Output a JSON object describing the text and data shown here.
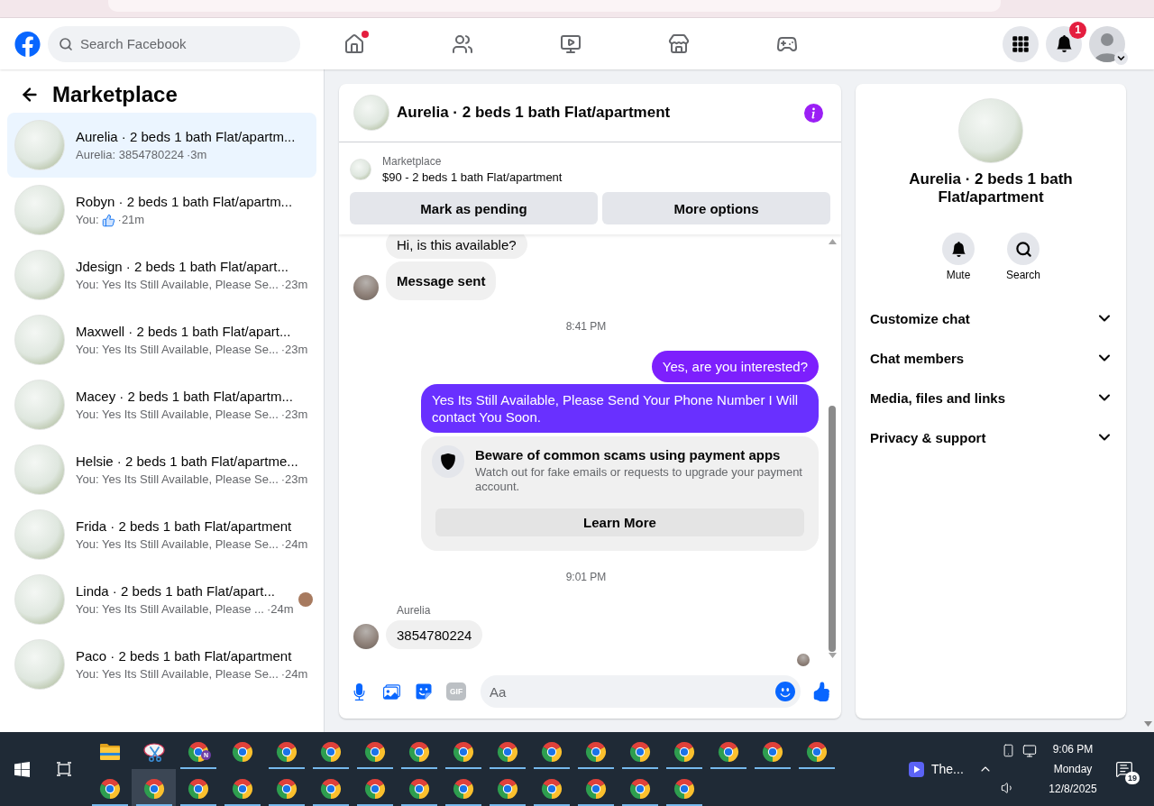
{
  "header": {
    "search": {
      "placeholder": "Search Facebook"
    },
    "nav": [
      {
        "kind": "home",
        "dot": true
      },
      {
        "kind": "friends",
        "dot": false
      },
      {
        "kind": "video",
        "dot": false
      },
      {
        "kind": "marketplace",
        "dot": false
      },
      {
        "kind": "gaming",
        "dot": false
      }
    ],
    "notification_count": "1"
  },
  "sidebar": {
    "title": "Marketplace",
    "conversations": [
      {
        "title": "Aurelia · 2 beds 1 bath Flat/apartm...",
        "kind": "text",
        "preview": "Aurelia: 3854780224",
        "time": "·3m",
        "selected": true,
        "seen": false
      },
      {
        "title": "Robyn · 2 beds 1 bath Flat/apartm...",
        "kind": "like",
        "preview": "You:",
        "time": "·21m",
        "selected": false,
        "seen": false
      },
      {
        "title": "Jdesign · 2 beds 1 bath Flat/apart...",
        "kind": "text",
        "preview": "You: Yes Its Still Available, Please Se...",
        "time": "·23m",
        "selected": false,
        "seen": false
      },
      {
        "title": "Maxwell · 2 beds 1 bath Flat/apart...",
        "kind": "text",
        "preview": "You: Yes Its Still Available, Please Se...",
        "time": "·23m",
        "selected": false,
        "seen": false
      },
      {
        "title": "Macey · 2 beds 1 bath Flat/apartm...",
        "kind": "text",
        "preview": "You: Yes Its Still Available, Please Se...",
        "time": "·23m",
        "selected": false,
        "seen": false
      },
      {
        "title": "Helsie · 2 beds 1 bath Flat/apartme...",
        "kind": "text",
        "preview": "You: Yes Its Still Available, Please Se...",
        "time": "·23m",
        "selected": false,
        "seen": false
      },
      {
        "title": "Frida · 2 beds 1 bath Flat/apartment",
        "kind": "text",
        "preview": "You: Yes Its Still Available, Please Se...",
        "time": "·24m",
        "selected": false,
        "seen": false
      },
      {
        "title": "Linda · 2 beds 1 bath Flat/apart...",
        "kind": "text",
        "preview": "You: Yes Its Still Available, Please ...",
        "time": "·24m",
        "selected": false,
        "seen": true
      },
      {
        "title": "Paco · 2 beds 1 bath Flat/apartment",
        "kind": "text",
        "preview": "You: Yes Its Still Available, Please Se...",
        "time": "·24m",
        "selected": false,
        "seen": false
      }
    ]
  },
  "chat": {
    "title": "Aurelia · 2 beds 1 bath Flat/apartment",
    "listing": {
      "label": "Marketplace",
      "name": "$90 - 2 beds 1 bath Flat/apartment"
    },
    "actions": [
      "Mark as pending",
      "More options"
    ],
    "messages": [
      {
        "kind": "incoming",
        "text": "Hi, is this available?",
        "avatar": false,
        "strong": false
      },
      {
        "kind": "incoming",
        "text": "Message sent",
        "avatar": true,
        "strong": true
      },
      {
        "kind": "timestamp",
        "text": "8:41 PM"
      },
      {
        "kind": "outgoing",
        "text": "Yes, are you interested?"
      },
      {
        "kind": "outgoing",
        "text": "Yes Its Still Available, Please Send Your Phone Number I Will contact You Soon."
      },
      {
        "kind": "notice",
        "title": "Beware of common scams using payment apps",
        "body": "Watch out for fake emails or requests to upgrade your payment account.",
        "button": "Learn More"
      },
      {
        "kind": "timestamp",
        "text": "9:01 PM"
      },
      {
        "kind": "incoming",
        "sender": "Aurelia",
        "text": "3854780224",
        "avatar": true,
        "strong": false
      }
    ],
    "seen": true,
    "composer": {
      "placeholder": "Aa",
      "gif_label": "GIF"
    }
  },
  "details": {
    "title": "Aurelia · 2 beds 1 bath Flat/apartment",
    "actions": [
      {
        "kind": "mute",
        "label": "Mute"
      },
      {
        "kind": "search",
        "label": "Search"
      }
    ],
    "sections": [
      {
        "label": "Customize chat",
        "expanded": false
      },
      {
        "label": "Chat members",
        "expanded": false
      },
      {
        "label": "Media, files and links",
        "expanded": false
      },
      {
        "label": "Privacy & support",
        "expanded": false
      }
    ]
  },
  "taskbar": {
    "apps": [
      {
        "kind": "folder",
        "running": false,
        "active": false
      },
      {
        "kind": "scissors",
        "running": false,
        "active": false
      },
      {
        "kind": "browser",
        "badge": "N",
        "running": true,
        "active": false
      },
      {
        "kind": "browser",
        "running": false,
        "active": false
      },
      {
        "kind": "browser",
        "running": true,
        "active": false
      },
      {
        "kind": "browser",
        "running": true,
        "active": false
      },
      {
        "kind": "browser",
        "running": true,
        "active": false
      },
      {
        "kind": "browser",
        "running": true,
        "active": false
      },
      {
        "kind": "browser",
        "running": true,
        "active": false
      },
      {
        "kind": "browser",
        "running": true,
        "active": false
      },
      {
        "kind": "browser",
        "running": true,
        "active": false
      },
      {
        "kind": "browser",
        "running": true,
        "active": false
      },
      {
        "kind": "browser",
        "running": true,
        "active": false
      },
      {
        "kind": "browser",
        "running": true,
        "active": false
      },
      {
        "kind": "browser",
        "running": true,
        "active": false
      },
      {
        "kind": "browser",
        "running": true,
        "active": false
      },
      {
        "kind": "browser",
        "running": true,
        "active": false
      },
      {
        "kind": "browser",
        "running": true,
        "active": false
      },
      {
        "kind": "browser",
        "running": true,
        "active": true
      },
      {
        "kind": "browser",
        "running": true,
        "active": false
      },
      {
        "kind": "browser",
        "running": true,
        "active": false
      },
      {
        "kind": "browser",
        "running": true,
        "active": false
      },
      {
        "kind": "browser",
        "running": true,
        "active": false
      },
      {
        "kind": "browser",
        "running": true,
        "active": false
      },
      {
        "kind": "browser",
        "running": true,
        "active": false
      },
      {
        "kind": "browser",
        "running": true,
        "active": false
      },
      {
        "kind": "browser",
        "running": true,
        "active": false
      },
      {
        "kind": "browser",
        "running": true,
        "active": false
      },
      {
        "kind": "browser",
        "running": true,
        "active": false
      },
      {
        "kind": "browser",
        "running": true,
        "active": false
      },
      {
        "kind": "browser",
        "running": true,
        "active": false
      }
    ],
    "window_label": "The...",
    "clock": {
      "time": "9:06 PM",
      "day": "Monday",
      "date": "12/8/2025"
    },
    "notification_count": "19"
  }
}
